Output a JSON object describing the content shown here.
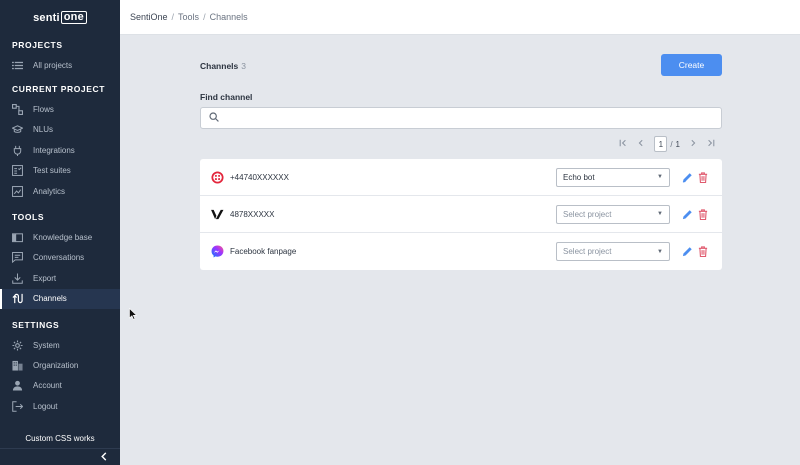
{
  "sidebar": {
    "logo": {
      "part1": "senti",
      "part2": "one"
    },
    "sections": [
      {
        "title": "PROJECTS",
        "items": [
          {
            "label": "All projects",
            "icon": "list-icon"
          }
        ]
      },
      {
        "title": "CURRENT PROJECT",
        "items": [
          {
            "label": "Flows",
            "icon": "flows-icon"
          },
          {
            "label": "NLUs",
            "icon": "graduation-cap-icon"
          },
          {
            "label": "Integrations",
            "icon": "plug-icon"
          },
          {
            "label": "Test suites",
            "icon": "test-suites-icon"
          },
          {
            "label": "Analytics",
            "icon": "analytics-icon"
          }
        ]
      },
      {
        "title": "TOOLS",
        "items": [
          {
            "label": "Knowledge base",
            "icon": "book-icon"
          },
          {
            "label": "Conversations",
            "icon": "chat-icon"
          },
          {
            "label": "Export",
            "icon": "download-icon"
          },
          {
            "label": "Channels",
            "icon": "channels-icon"
          }
        ]
      },
      {
        "title": "SETTINGS",
        "items": [
          {
            "label": "System",
            "icon": "gear-icon"
          },
          {
            "label": "Organization",
            "icon": "building-icon"
          },
          {
            "label": "Account",
            "icon": "user-icon"
          },
          {
            "label": "Logout",
            "icon": "logout-icon"
          }
        ]
      }
    ],
    "footer_text": "Custom CSS works"
  },
  "breadcrumb": {
    "items": [
      "SentiOne",
      "Tools",
      "Channels"
    ],
    "separator": "/"
  },
  "main": {
    "title": "Channels",
    "count": "3",
    "create_label": "Create",
    "find_label": "Find channel",
    "search_value": "",
    "pagination": {
      "current": "1",
      "separator": "/",
      "total": "1"
    },
    "channels": [
      {
        "name": "+44740XXXXXX",
        "icon": "twilio-icon",
        "select_value": "Echo bot",
        "is_placeholder": false
      },
      {
        "name": "4878XXXXX",
        "icon": "vonage-icon",
        "select_value": "Select project",
        "is_placeholder": true
      },
      {
        "name": "Facebook fanpage",
        "icon": "messenger-icon",
        "select_value": "Select project",
        "is_placeholder": true
      }
    ]
  },
  "colors": {
    "sidebar_bg": "#1e2a3c",
    "accent": "#4c8ef0",
    "delete": "#e05a6e",
    "twilio": "#e3263c"
  }
}
